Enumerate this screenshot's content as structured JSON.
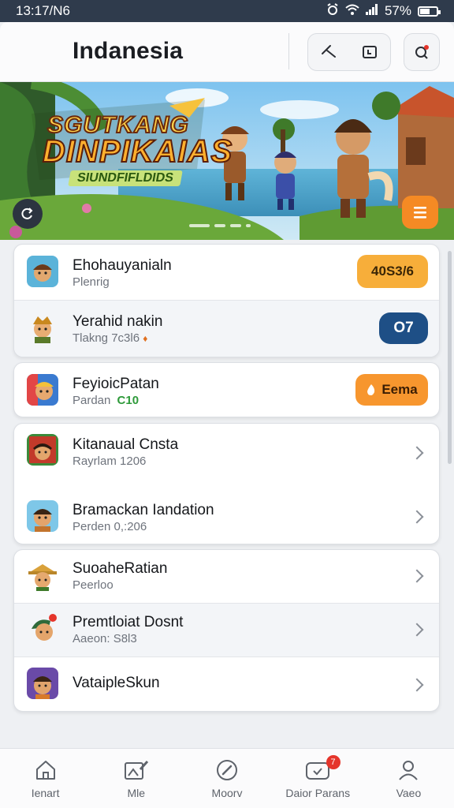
{
  "status_bar": {
    "time": "13:17/N6",
    "battery": "57%"
  },
  "header": {
    "title": "Indanesia"
  },
  "banner": {
    "title_line1": "SGUTKANG",
    "title_line2": "DINPIKAIAS",
    "title_line3": "SIUNDFIFLDIDS",
    "slide_count": 4,
    "active_slide": 1
  },
  "lists": {
    "card1": [
      {
        "title": "Ehohauyanialn",
        "subtitle": "Plenrig",
        "action": "40S3/6",
        "action_style": "orange"
      },
      {
        "title": "Yerahid nakin",
        "subtitle": "Tlakng 7c3l6",
        "subtitle_glyph": "♦",
        "action": "O7",
        "action_style": "navy"
      }
    ],
    "card2": [
      {
        "title": "FeyioicPatan",
        "subtitle": "Pardan",
        "subtitle_badge": "C10",
        "action": "Eema",
        "action_style": "orange-flame"
      }
    ],
    "card3": [
      {
        "title": "Kitanaual Cnsta",
        "subtitle": "Rayrlam 1206"
      },
      {
        "title": "Bramackan Iandation",
        "subtitle": "Perden 0,:206"
      }
    ],
    "card4": [
      {
        "title": "SuoaheRatian",
        "subtitle": "Peerloo"
      },
      {
        "title": "Premtloiat Dosnt",
        "subtitle": "Aaeon: S8l3"
      },
      {
        "title": "VataipleSkun",
        "subtitle": ""
      }
    ]
  },
  "bottom_nav": [
    {
      "label": "Ienart",
      "icon": "home-icon"
    },
    {
      "label": "Mle",
      "icon": "image-edit-icon"
    },
    {
      "label": "Moorv",
      "icon": "compass-icon"
    },
    {
      "label": "Daior Parans",
      "icon": "game-controller-icon",
      "badge": "7"
    },
    {
      "label": "Vaeo",
      "icon": "profile-icon"
    }
  ],
  "colors": {
    "accent_orange": "#f5a623",
    "navy": "#1e4f86",
    "statusbar": "#2f3b4c"
  }
}
